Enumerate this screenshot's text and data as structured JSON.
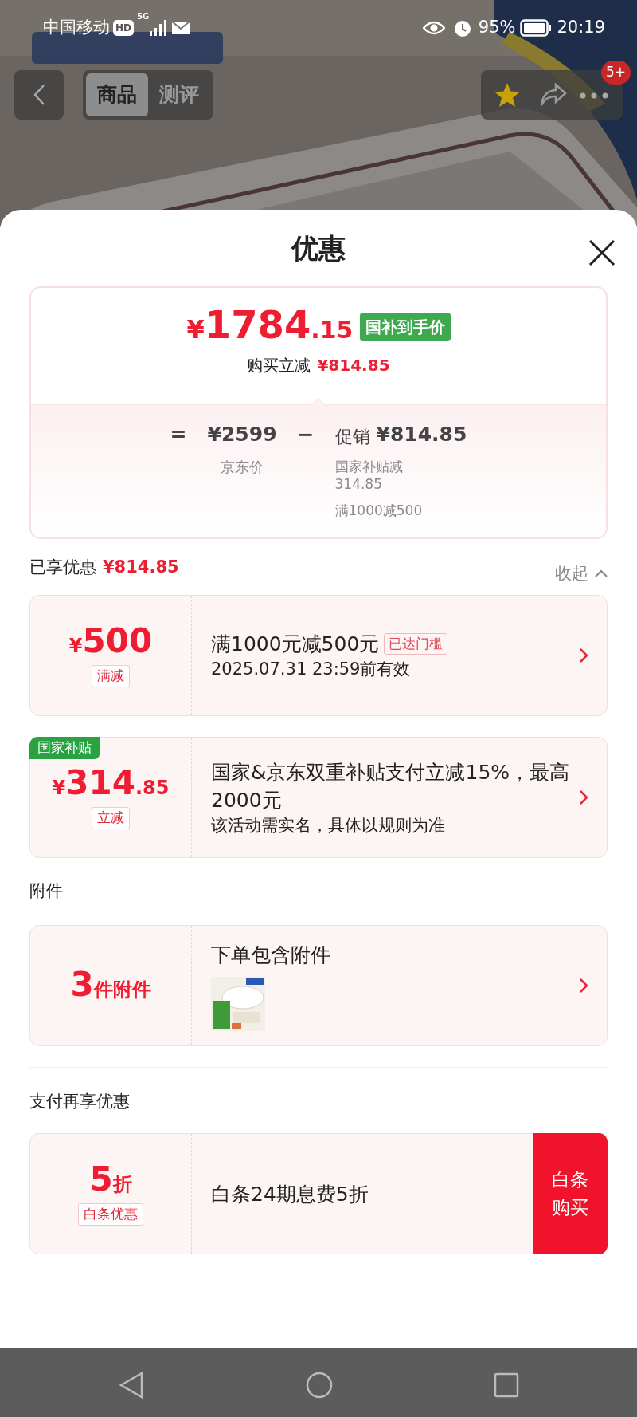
{
  "status_bar": {
    "carrier": "中国移动",
    "hd": "HD",
    "network": "5G",
    "battery": "95%",
    "time": "20:19"
  },
  "top_nav": {
    "tabs": [
      {
        "label": "商品",
        "selected": true
      },
      {
        "label": "测评",
        "selected": false
      }
    ],
    "badge": "5+"
  },
  "sheet": {
    "title": "优惠"
  },
  "price_summary": {
    "currency": "¥",
    "price_main": "1784",
    "price_decimal": ".15",
    "tag": "国补到手价",
    "saving_label": "购买立减",
    "saving_amount": "¥814.85",
    "equals": "=",
    "base_price": "¥2599",
    "base_label": "京东价",
    "minus": "−",
    "promo_label": "促销",
    "promo_amount": "¥814.85",
    "promo_items": [
      "国家补贴减314.85",
      "满1000减500"
    ]
  },
  "enjoyed": {
    "label": "已享优惠",
    "amount": "¥814.85",
    "toggle": "收起"
  },
  "coupons": [
    {
      "currency": "¥",
      "amount": "500",
      "type_tag": "满减",
      "title": "满1000元减500元",
      "status_tag": "已达门槛",
      "lines": [
        "2025.07.31 23:59前有效"
      ]
    },
    {
      "corner_tag": "国家补贴",
      "currency": "¥",
      "amount": "314",
      "decimal": ".85",
      "type_tag": "立减",
      "title": "国家&京东双重补贴支付立减15%，最高2000元",
      "lines": [
        "该活动需实名，具体以规则为准"
      ]
    }
  ],
  "attachments": {
    "heading": "附件",
    "cards": [
      {
        "amount": "3",
        "unit": "件附件",
        "title": "下单包含附件"
      }
    ]
  },
  "payment": {
    "heading": "支付再享优惠",
    "cards": [
      {
        "amount": "5",
        "unit": "折",
        "type_tag": "白条优惠",
        "title": "白条24期息费5折",
        "action": "白条购买"
      }
    ]
  }
}
